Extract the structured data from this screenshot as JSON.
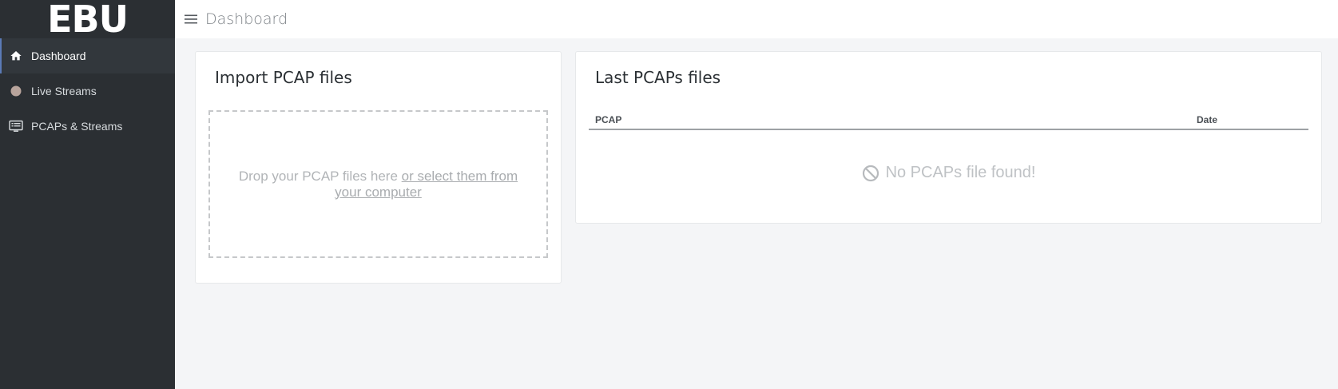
{
  "sidebar": {
    "logo": "EBU",
    "items": [
      {
        "label": "Dashboard",
        "icon": "home-icon",
        "active": true
      },
      {
        "label": "Live Streams",
        "icon": "circle-icon",
        "active": false
      },
      {
        "label": "PCAPs & Streams",
        "icon": "list-alt-icon",
        "active": false
      }
    ]
  },
  "topbar": {
    "menu_icon": "hamburger-menu-icon",
    "title": "Dashboard"
  },
  "import_card": {
    "title": "Import PCAP files",
    "drop_text": "Drop your PCAP files here ",
    "select_link": "or select them from your computer"
  },
  "pcaps_card": {
    "title": "Last PCAPs files",
    "columns": [
      "PCAP",
      "Date"
    ],
    "empty_icon": "ban-icon",
    "empty_text": "No PCAPs file found!"
  },
  "colors": {
    "sidebar_bg": "#2b2f33",
    "active_item_bg": "#32373c",
    "active_indicator": "#5b7bb7",
    "page_bg": "#f4f5f7"
  }
}
